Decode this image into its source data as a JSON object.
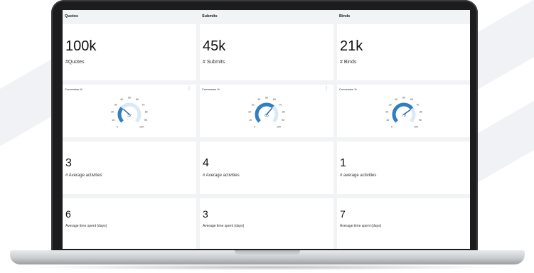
{
  "columns": [
    {
      "header": "Quotes",
      "count": "100k",
      "count_label": "#Quotes",
      "gauge_title": "Conversion %",
      "gauge_menu": "⋮",
      "gauge_value": "32",
      "gauge_fraction": 0.32,
      "gauge_ticks": [
        "0",
        "10",
        "20",
        "30",
        "40",
        "50",
        "60",
        "70",
        "80",
        "90",
        "100"
      ],
      "activities": "3",
      "activities_label": "# Average activities",
      "time_spent": "6",
      "time_spent_label": "Average time spent (days)"
    },
    {
      "header": "Submits",
      "count": "45k",
      "count_label": "# Submits",
      "gauge_title": "Conversion %",
      "gauge_menu": "⋮",
      "gauge_value": "65",
      "gauge_fraction": 0.65,
      "gauge_ticks": [
        "0",
        "10",
        "20",
        "30",
        "40",
        "50",
        "60",
        "70",
        "80",
        "90",
        "100"
      ],
      "activities": "4",
      "activities_label": "# Average activities",
      "time_spent": "3",
      "time_spent_label": "Average time spent (days)"
    },
    {
      "header": "Binds",
      "count": "21k",
      "count_label": "# Binds",
      "gauge_title": "Conversion %",
      "gauge_menu": "",
      "gauge_value": "70",
      "gauge_fraction": 0.7,
      "gauge_ticks": [
        "0",
        "10",
        "20",
        "30",
        "40",
        "50",
        "60",
        "70",
        "80",
        "90",
        "100"
      ],
      "activities": "1",
      "activities_label": "# average activities",
      "time_spent": "7",
      "time_spent_label": "Average time spent (days)"
    }
  ],
  "colors": {
    "gauge_fill": "#2f7fc1",
    "gauge_track": "#dbe9f5",
    "needle": "#1f5f99"
  }
}
